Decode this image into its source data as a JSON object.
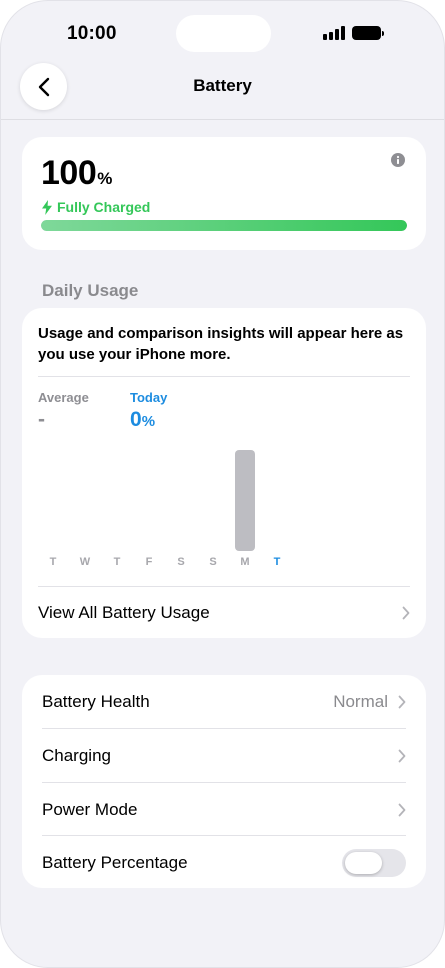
{
  "status_bar": {
    "time": "10:00",
    "signal_icon": "signal-bars-icon",
    "battery_icon": "battery-full-icon"
  },
  "nav": {
    "back_icon": "chevron-left-icon",
    "title": "Battery"
  },
  "battery_level": {
    "value": "100",
    "unit": "%",
    "status": "Fully Charged",
    "status_icon": "bolt-icon",
    "info_icon": "info-icon",
    "level_fraction": 1.0,
    "accent_color": "#34c759"
  },
  "daily_usage": {
    "section_title": "Daily Usage",
    "insight_text": "Usage and comparison insights will appear here as you use your iPhone more.",
    "average_label": "Average",
    "average_value": "-",
    "today_label": "Today",
    "today_value": "0",
    "today_unit": "%",
    "today_color": "#1c8ce0",
    "days": [
      "T",
      "W",
      "T",
      "F",
      "S",
      "S",
      "M",
      "T"
    ],
    "view_all_label": "View All Battery Usage"
  },
  "settings": {
    "battery_health_label": "Battery Health",
    "battery_health_value": "Normal",
    "charging_label": "Charging",
    "power_mode_label": "Power Mode",
    "battery_percentage_label": "Battery Percentage",
    "battery_percentage_on": false
  }
}
